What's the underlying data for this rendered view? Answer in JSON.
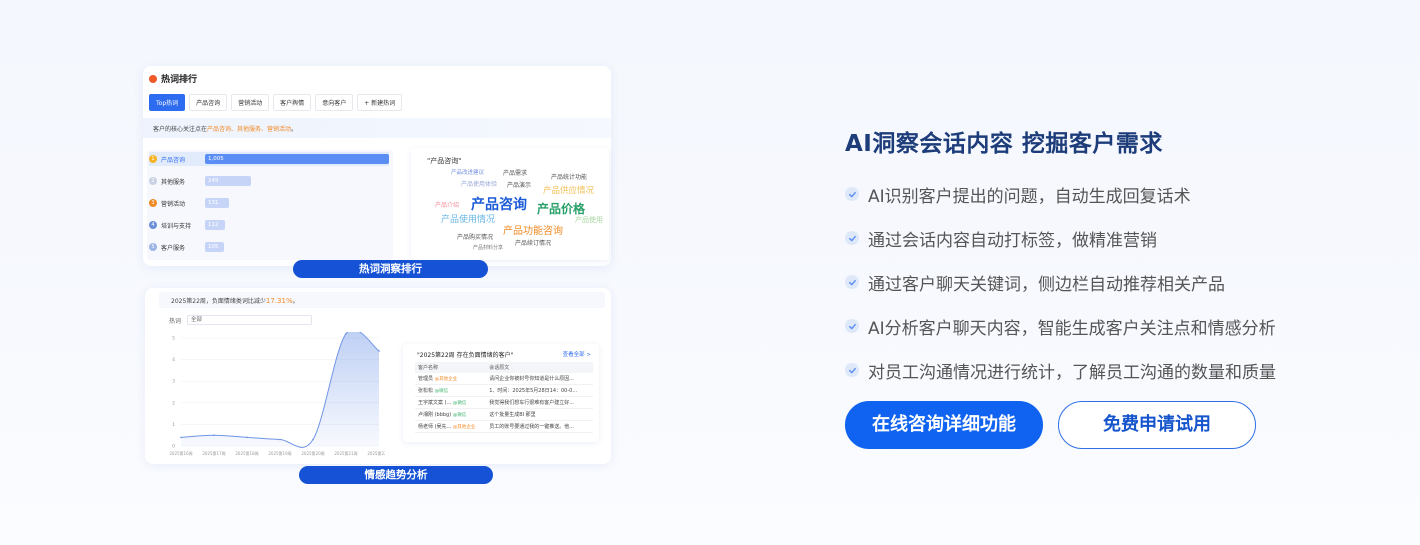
{
  "hot_card": {
    "title": "热词排行",
    "tabs": [
      {
        "label": "Top热词",
        "active": true
      },
      {
        "label": "产品咨询"
      },
      {
        "label": "营销活动"
      },
      {
        "label": "客户舆情"
      },
      {
        "label": "意向客户"
      },
      {
        "label": "+ 新建热词"
      }
    ],
    "focus": {
      "prefix": "客户的核心关注点在",
      "highlights": "产品咨询、其他服务、营销活动",
      "suffix": "。"
    },
    "ranking": [
      {
        "rank": "1",
        "name": "产品咨询",
        "value": "1,005",
        "fraction": 1.0
      },
      {
        "rank": "2",
        "name": "其他服务",
        "value": "249",
        "fraction": 0.25
      },
      {
        "rank": "3",
        "name": "营销活动",
        "value": "131",
        "fraction": 0.13
      },
      {
        "rank": "4",
        "name": "培训与支持",
        "value": "112",
        "fraction": 0.11
      },
      {
        "rank": "5",
        "name": "客户服务",
        "value": "105",
        "fraction": 0.105
      }
    ],
    "cloud_title": "\"产品咨询\"",
    "cloud_words": [
      "产品咨询",
      "产品价格",
      "产品功能咨询",
      "产品使用情况",
      "产品供应情况",
      "产品统计功能",
      "产品需求",
      "产品演示",
      "产品购买情况",
      "产品续订情况",
      "产品改进建议",
      "产品使用体验",
      "产品介绍",
      "产品使用",
      "产品材料分享"
    ],
    "caption": "热词洞察排行"
  },
  "sentiment_card": {
    "headline_prefix": "2025第22周，负面情绪类词比减少",
    "headline_pct": "17.31%",
    "headline_suffix": "。",
    "filter_label": "热词",
    "filter_value": "全部",
    "table_title": "\"2025第22周 存在负面情绪的客户\"",
    "table_more": "查看全部 >",
    "table_headers": [
      "客户名称",
      "会话原文"
    ],
    "table_rows": [
      {
        "name": "管理员",
        "tag": "@其他企业",
        "tag_type": "neg",
        "text": "请问企业你被封号你知道是什么原因..."
      },
      {
        "name": "张松松",
        "tag": "@微信",
        "tag_type": "pos",
        "text": "1、时间：2025年5月28日14：00-0..."
      },
      {
        "name": "王宇斌文案 (...",
        "tag": "@微信",
        "tag_type": "pos",
        "text": "我觉得我们想车行很难有客户建立好..."
      },
      {
        "name": "卢湘刚 (bbbg)",
        "tag": "@微信",
        "tag_type": "pos",
        "text": "这个批量生成BI 那里"
      },
      {
        "name": "杨老师 (吴先...",
        "tag": "@其他企业",
        "tag_type": "neg",
        "text": "员工的账号要通过我的一键推送。他..."
      }
    ],
    "caption": "情感趋势分析"
  },
  "chart_data": {
    "type": "area",
    "x": [
      "2025第16周",
      "2025第17周",
      "2025第18周",
      "2025第19周",
      "2025第20周",
      "2025第21周",
      "2025第22周"
    ],
    "values": [
      0.4,
      0.5,
      0.4,
      0.3,
      0.3,
      5.2,
      4.4
    ],
    "ylim": [
      0,
      5
    ],
    "yticks": [
      "0",
      "1",
      "2",
      "3",
      "4",
      "5"
    ],
    "grid": true,
    "color": "#6f95e8"
  },
  "right": {
    "headline": "AI洞察会话内容  挖掘客户需求",
    "features": [
      "AI识别客户提出的问题，自动生成回复话术",
      "通过会话内容自动打标签，做精准营销",
      "通过客户聊天关键词，侧边栏自动推荐相关产品",
      "AI分析客户聊天内容，智能生成客户关注点和情感分析",
      "对员工沟通情况进行统计，了解员工沟通的数量和质量"
    ],
    "buttons": {
      "consult": "在线咨询详细功能",
      "trial": "免费申请试用"
    },
    "colors": {
      "primary": "#0f63f0",
      "headline": "#1d3c7a",
      "check_icon": "#5b8ef5"
    }
  }
}
